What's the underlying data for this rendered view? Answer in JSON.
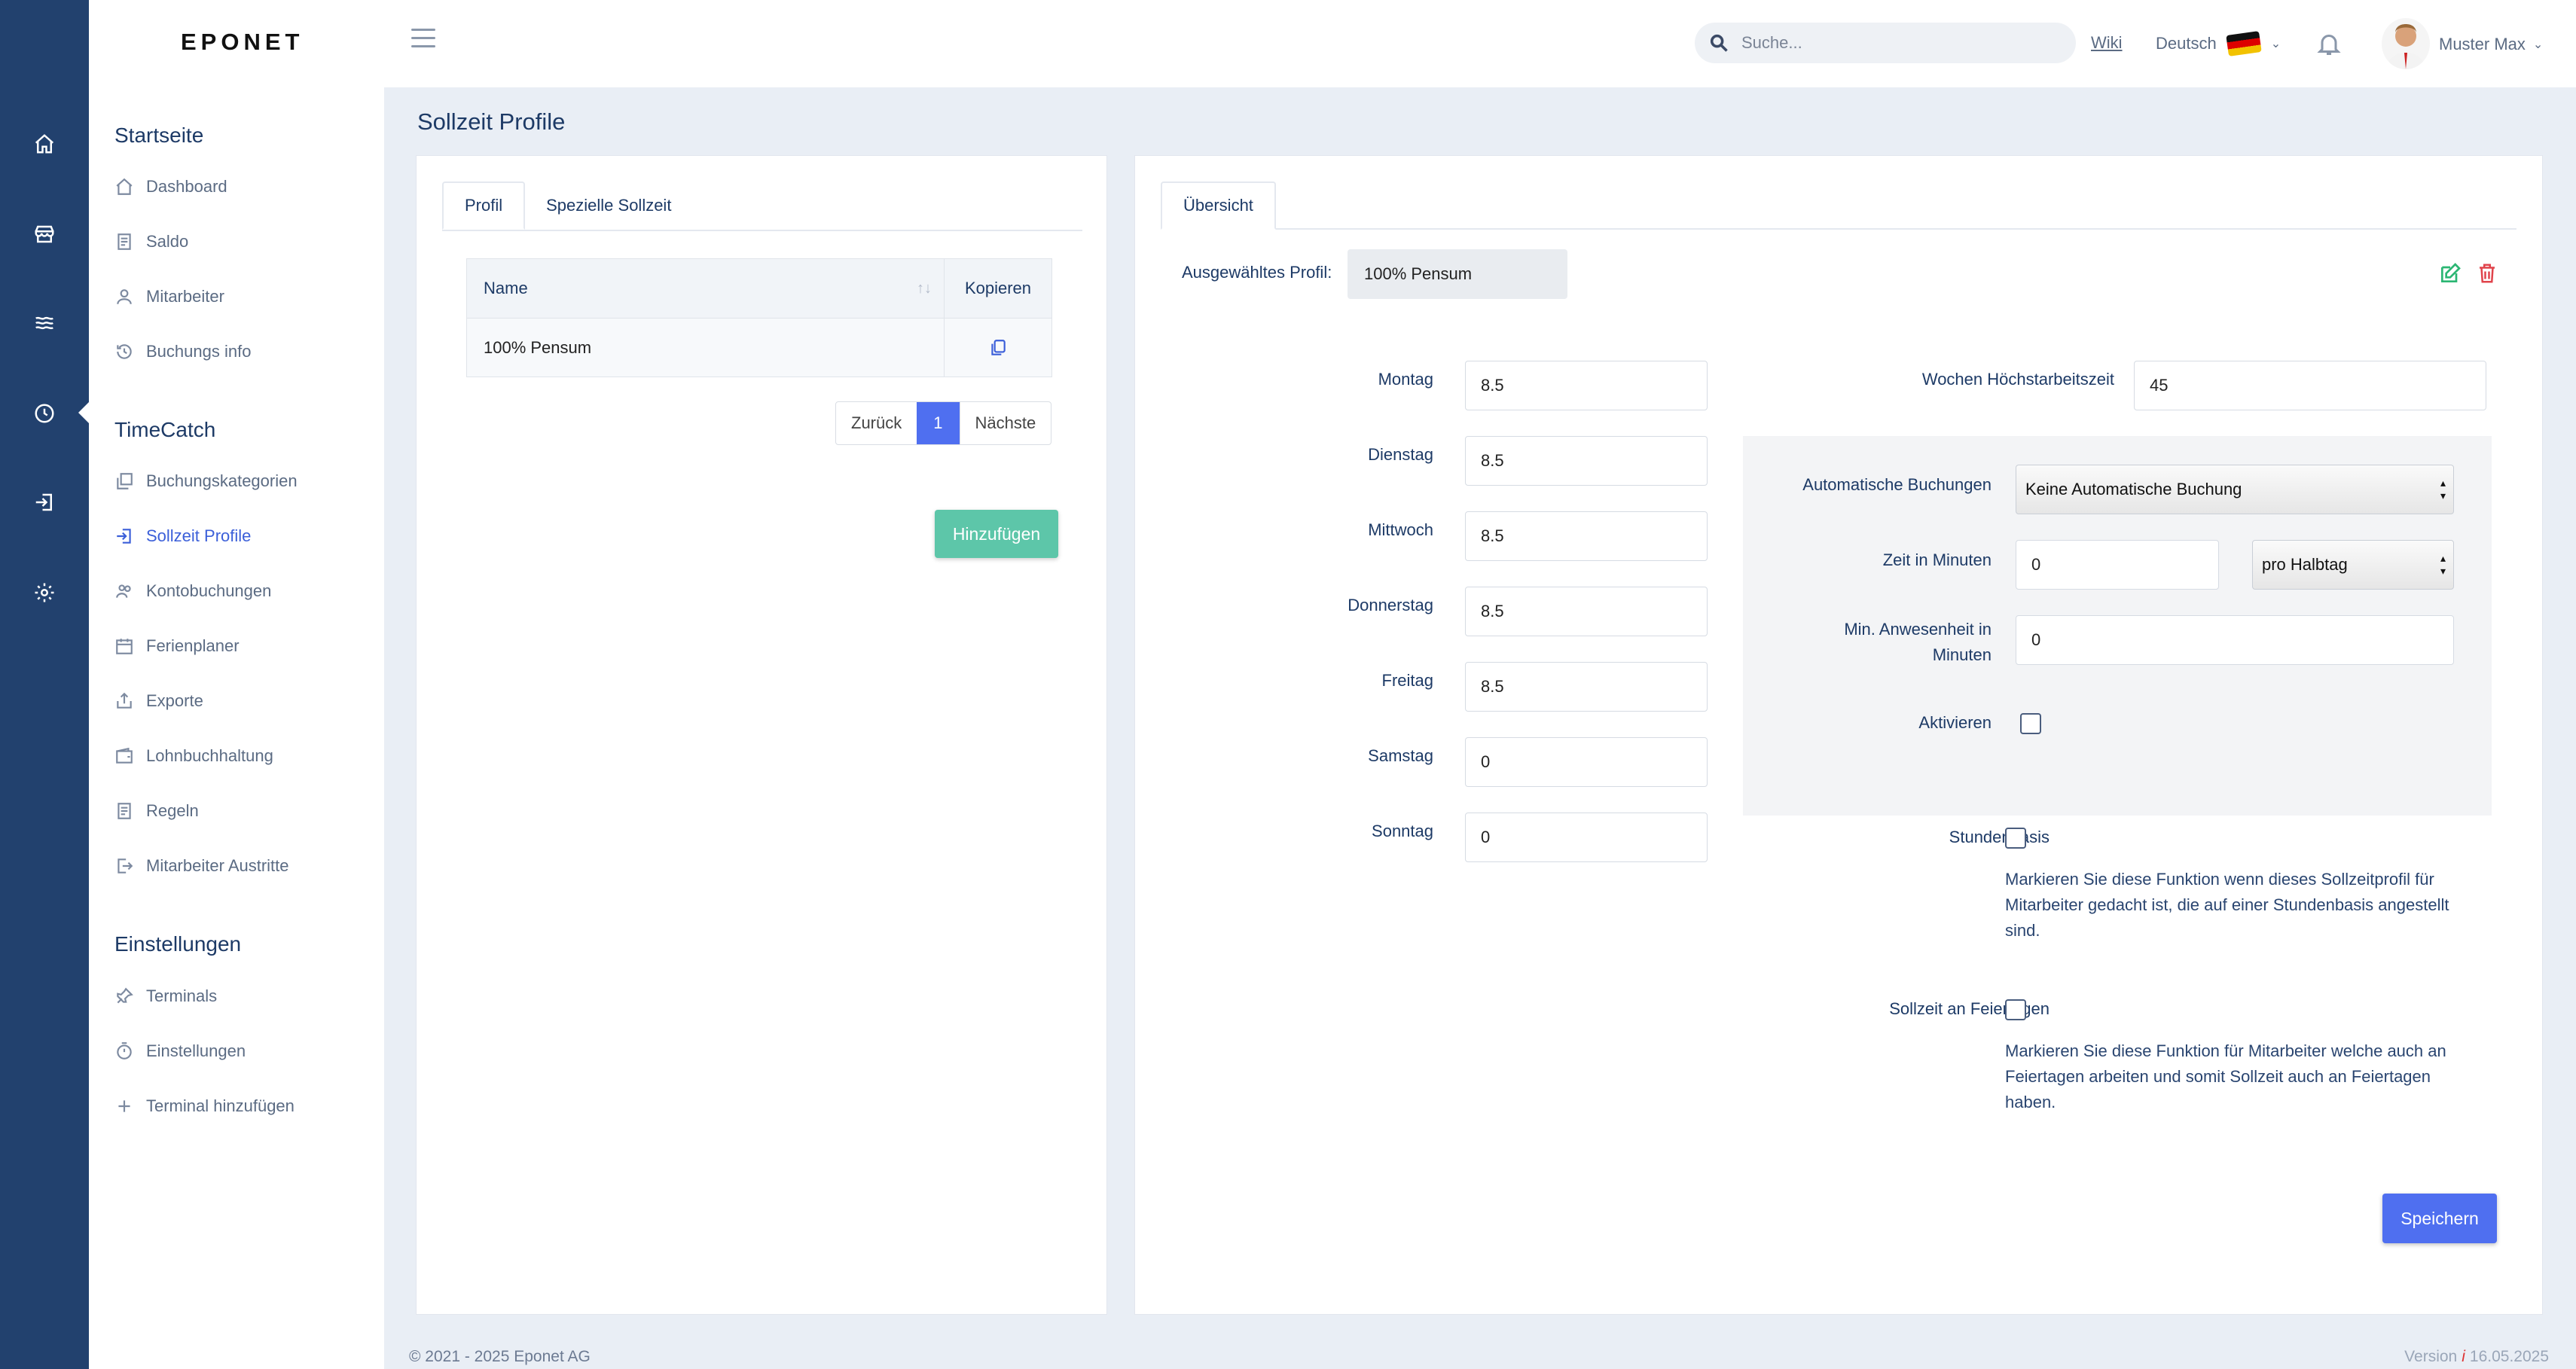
{
  "app": {
    "logo": "EPONET"
  },
  "rail": {
    "icons": [
      "home-icon",
      "store-icon",
      "waves-icon",
      "clock-icon",
      "login-icon",
      "gear-icon"
    ]
  },
  "sidebar": {
    "sections": [
      {
        "title": "Startseite",
        "items": [
          {
            "label": "Dashboard",
            "icon": "home-icon"
          },
          {
            "label": "Saldo",
            "icon": "document-icon"
          },
          {
            "label": "Mitarbeiter",
            "icon": "user-icon"
          },
          {
            "label": "Buchungs info",
            "icon": "history-icon"
          }
        ]
      },
      {
        "title": "TimeCatch",
        "items": [
          {
            "label": "Buchungskategorien",
            "icon": "copy-icon"
          },
          {
            "label": "Sollzeit Profile",
            "icon": "login-icon",
            "active": true
          },
          {
            "label": "Kontobuchungen",
            "icon": "users-icon"
          },
          {
            "label": "Ferienplaner",
            "icon": "calendar-icon"
          },
          {
            "label": "Exporte",
            "icon": "share-icon"
          },
          {
            "label": "Lohnbuchhaltung",
            "icon": "wallet-icon"
          },
          {
            "label": "Regeln",
            "icon": "document-icon"
          },
          {
            "label": "Mitarbeiter Austritte",
            "icon": "logout-icon"
          }
        ]
      },
      {
        "title": "Einstellungen",
        "items": [
          {
            "label": "Terminals",
            "icon": "pin-icon"
          },
          {
            "label": "Einstellungen",
            "icon": "timer-icon"
          },
          {
            "label": "Terminal hinzufügen",
            "icon": "plus-icon"
          }
        ]
      }
    ]
  },
  "topbar": {
    "search_placeholder": "Suche...",
    "wiki": "Wiki",
    "language": "Deutsch",
    "user": "Muster Max"
  },
  "page": {
    "title": "Sollzeit Profile"
  },
  "left": {
    "tabs": [
      "Profil",
      "Spezielle Sollzeit"
    ],
    "table": {
      "headers": {
        "name": "Name",
        "copy": "Kopieren"
      },
      "rows": [
        {
          "name": "100% Pensum"
        }
      ]
    },
    "pager": {
      "prev": "Zurück",
      "current": "1",
      "next": "Nächste"
    },
    "add_button": "Hinzufügen"
  },
  "right": {
    "tab": "Übersicht",
    "selected_label": "Ausgewähltes Profil:",
    "selected_value": "100% Pensum",
    "days": [
      {
        "label": "Montag",
        "value": "8.5"
      },
      {
        "label": "Dienstag",
        "value": "8.5"
      },
      {
        "label": "Mittwoch",
        "value": "8.5"
      },
      {
        "label": "Donnerstag",
        "value": "8.5"
      },
      {
        "label": "Freitag",
        "value": "8.5"
      },
      {
        "label": "Samstag",
        "value": "0"
      },
      {
        "label": "Sonntag",
        "value": "0"
      }
    ],
    "weekly_max": {
      "label": "Wochen Höchstarbeitszeit",
      "value": "45"
    },
    "auto_booking": {
      "label": "Automatische Buchungen",
      "value": "Keine Automatische Buchung"
    },
    "time_minutes": {
      "label": "Zeit in Minuten",
      "value": "0",
      "unit": "pro Halbtag"
    },
    "min_presence": {
      "label_1": "Min. Anwesenheit in",
      "label_2": "Minuten",
      "value": "0"
    },
    "activate": {
      "label": "Aktivieren"
    },
    "hour_basis": {
      "label": "Stundenbasis",
      "help_1": "Markieren Sie diese Funktion wenn dieses Sollzeitprofil für",
      "help_2": "Mitarbeiter gedacht ist, die auf einer Stundenbasis angestellt",
      "help_3": "sind."
    },
    "holidays": {
      "label": "Sollzeit an Feiertagen",
      "help_1": "Markieren Sie diese Funktion für Mitarbeiter welche auch an",
      "help_2": "Feiertagen arbeiten und somit Sollzeit auch an Feiertagen",
      "help_3": "haben."
    },
    "save_button": "Speichern"
  },
  "footer": {
    "copyright": "© 2021 - 2025 Eponet AG",
    "version_label": "Version",
    "version_icon": "i",
    "version_date": "16.05.2025"
  },
  "colors": {
    "rail": "#22416e",
    "accent": "#4f6ff0",
    "add": "#5dc6a9",
    "edit": "#2bb673",
    "delete": "#e0434b"
  }
}
